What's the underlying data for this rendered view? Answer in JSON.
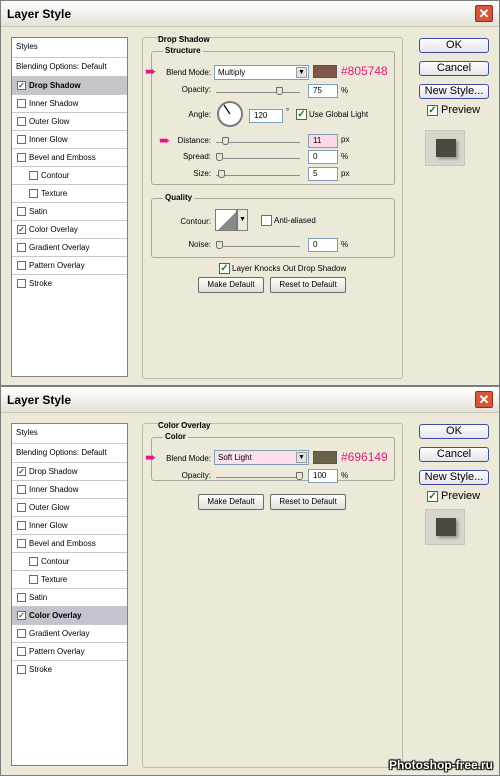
{
  "dialog1": {
    "title": "Layer Style",
    "close_glyph": "✕",
    "sidebar": {
      "styles": "Styles",
      "blending": "Blending Options: Default",
      "items": [
        {
          "label": "Drop Shadow",
          "checked": "✓"
        },
        {
          "label": "Inner Shadow",
          "checked": ""
        },
        {
          "label": "Outer Glow",
          "checked": ""
        },
        {
          "label": "Inner Glow",
          "checked": ""
        },
        {
          "label": "Bevel and Emboss",
          "checked": ""
        },
        {
          "label": "Contour",
          "checked": ""
        },
        {
          "label": "Texture",
          "checked": ""
        },
        {
          "label": "Satin",
          "checked": ""
        },
        {
          "label": "Color Overlay",
          "checked": "✓"
        },
        {
          "label": "Gradient Overlay",
          "checked": ""
        },
        {
          "label": "Pattern Overlay",
          "checked": ""
        },
        {
          "label": "Stroke",
          "checked": ""
        }
      ]
    },
    "section": "Drop Shadow",
    "structure": {
      "title": "Structure",
      "blend_label": "Blend Mode:",
      "blend_value": "Multiply",
      "color": "#805748",
      "hex": "#805748",
      "opacity_label": "Opacity:",
      "opacity": "75",
      "opacity_pct": 0.75,
      "angle_label": "Angle:",
      "angle": "120",
      "deg": "°",
      "global_light": "Use Global Light",
      "global_checked": "✓",
      "distance_label": "Distance:",
      "distance": "11",
      "distance_pct": 0.07,
      "spread_label": "Spread:",
      "spread": "0",
      "spread_pct": 0,
      "size_label": "Size:",
      "size": "5",
      "size_pct": 0.03
    },
    "quality": {
      "title": "Quality",
      "contour_label": "Contour:",
      "anti_aliased": "Anti-aliased",
      "noise_label": "Noise:",
      "noise": "0",
      "noise_pct": 0
    },
    "knocks_out": "Layer Knocks Out Drop Shadow",
    "knocks_checked": "✓",
    "make_default": "Make Default",
    "reset_default": "Reset to Default",
    "buttons": {
      "ok": "OK",
      "cancel": "Cancel",
      "new_style": "New Style...",
      "preview": "Preview",
      "preview_checked": "✓"
    },
    "units": {
      "pct": "%",
      "px": "px"
    }
  },
  "dialog2": {
    "title": "Layer Style",
    "close_glyph": "✕",
    "sidebar": {
      "styles": "Styles",
      "blending": "Blending Options: Default",
      "items": [
        {
          "label": "Drop Shadow",
          "checked": "✓"
        },
        {
          "label": "Inner Shadow",
          "checked": ""
        },
        {
          "label": "Outer Glow",
          "checked": ""
        },
        {
          "label": "Inner Glow",
          "checked": ""
        },
        {
          "label": "Bevel and Emboss",
          "checked": ""
        },
        {
          "label": "Contour",
          "checked": ""
        },
        {
          "label": "Texture",
          "checked": ""
        },
        {
          "label": "Satin",
          "checked": ""
        },
        {
          "label": "Color Overlay",
          "checked": "✓"
        },
        {
          "label": "Gradient Overlay",
          "checked": ""
        },
        {
          "label": "Pattern Overlay",
          "checked": ""
        },
        {
          "label": "Stroke",
          "checked": ""
        }
      ]
    },
    "section": "Color Overlay",
    "color_box": {
      "title": "Color",
      "blend_label": "Blend Mode:",
      "blend_value": "Soft Light",
      "color": "#696149",
      "hex": "#696149",
      "opacity_label": "Opacity:",
      "opacity": "100",
      "opacity_pct": 1.0
    },
    "make_default": "Make Default",
    "reset_default": "Reset to Default",
    "buttons": {
      "ok": "OK",
      "cancel": "Cancel",
      "new_style": "New Style...",
      "preview": "Preview",
      "preview_checked": "✓"
    },
    "units": {
      "pct": "%"
    }
  },
  "watermark": "Photoshop-free.ru",
  "colors": {
    "highlight_arrow": "#e0197c",
    "selected_item": "#c3c4cc"
  }
}
